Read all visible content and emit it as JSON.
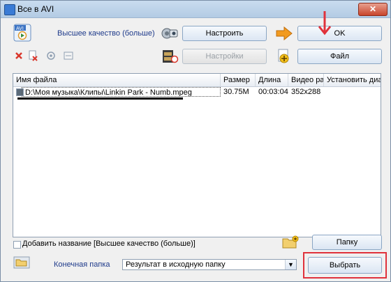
{
  "window": {
    "title": "Все в AVI",
    "close_glyph": "✕"
  },
  "quality_label": "Высшее качество (больше)",
  "buttons": {
    "configure": "Настроить",
    "settings": "Настройки",
    "ok": "OK",
    "file": "Файл",
    "folder": "Папку",
    "choose": "Выбрать"
  },
  "app_icon_text": "AVI",
  "file_table": {
    "columns": [
      "Имя файла",
      "Размер",
      "Длина",
      "Видео ра...",
      "Установить диа..."
    ],
    "rows": [
      {
        "name": "D:\\Моя музыка\\Клипы\\Linkin Park - Numb.mpeg",
        "size": "30.75M",
        "length": "00:03:04",
        "video": "352x288",
        "set": ""
      }
    ]
  },
  "add_title_label": "Добавить название [Высшее качество (больше)]",
  "dest_folder_label": "Конечная папка",
  "dest_folder_value": "Результат в исходную папку",
  "colors": {
    "annotation": "#e0323b",
    "ok_arrow": "#f29a1f",
    "delete": "#d9362b"
  }
}
